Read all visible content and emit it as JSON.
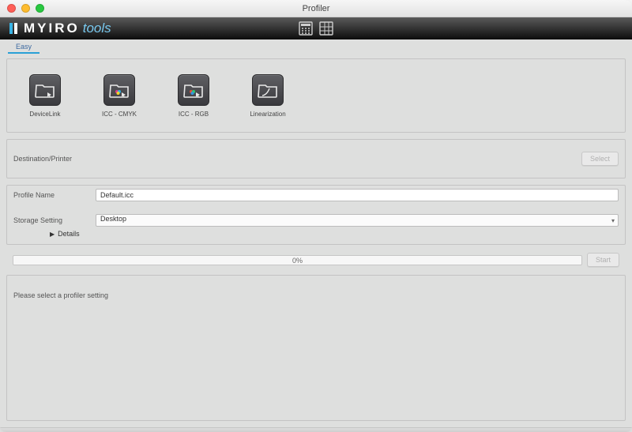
{
  "window": {
    "title": "Profiler"
  },
  "brand": {
    "name": "MYIRO",
    "suffix": "tools"
  },
  "tabs": [
    {
      "label": "Easy"
    }
  ],
  "profiles": [
    {
      "label": "DeviceLink"
    },
    {
      "label": "ICC - CMYK"
    },
    {
      "label": "ICC - RGB"
    },
    {
      "label": "Linearization"
    }
  ],
  "destination": {
    "label": "Destination/Printer",
    "select_button": "Select"
  },
  "profile_name": {
    "label": "Profile Name",
    "value": "Default.icc"
  },
  "storage": {
    "label": "Storage Setting",
    "value": "Desktop",
    "details_label": "Details"
  },
  "progress": {
    "percent_text": "0%",
    "start_button": "Start"
  },
  "status": {
    "message": "Please select a profiler setting"
  }
}
